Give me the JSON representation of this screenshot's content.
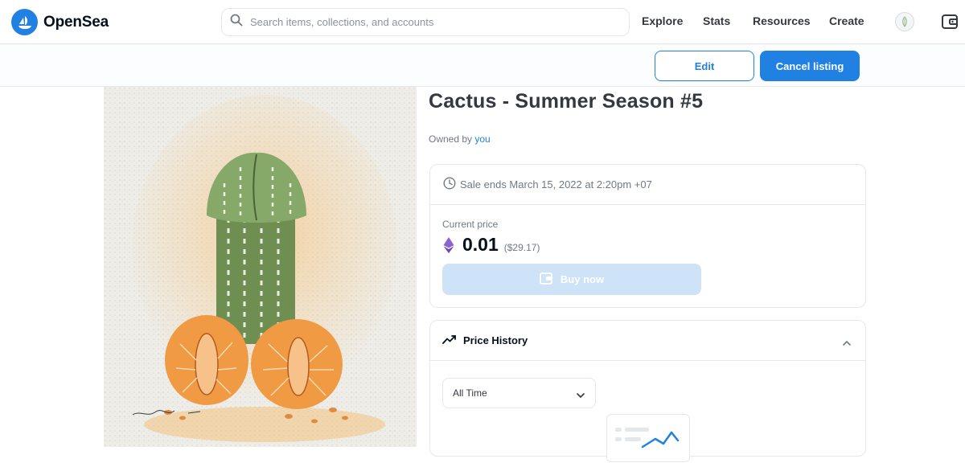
{
  "brand": {
    "name": "OpenSea",
    "color": "#2081e2"
  },
  "search": {
    "placeholder": "Search items, collections, and accounts",
    "icon": "search-icon"
  },
  "nav": {
    "items": [
      {
        "label": "Explore"
      },
      {
        "label": "Stats"
      },
      {
        "label": "Resources"
      },
      {
        "label": "Create"
      }
    ]
  },
  "header_icons": {
    "avatar": "avatar",
    "wallet": "wallet-icon"
  },
  "actions": {
    "edit_label": "Edit",
    "cancel_label": "Cancel listing"
  },
  "item": {
    "title": "Cactus - Summer Season #5",
    "owned_prefix": "Owned by",
    "owner": "you",
    "artwork_signature": "Kha mi da"
  },
  "sale": {
    "ends_text": "Sale ends March 15, 2022 at 2:20pm +07",
    "current_price_label": "Current price",
    "price": "0.01",
    "usd": "($29.17)",
    "buy_label": "Buy now"
  },
  "price_history": {
    "title": "Price History",
    "filter_value": "All Time"
  }
}
